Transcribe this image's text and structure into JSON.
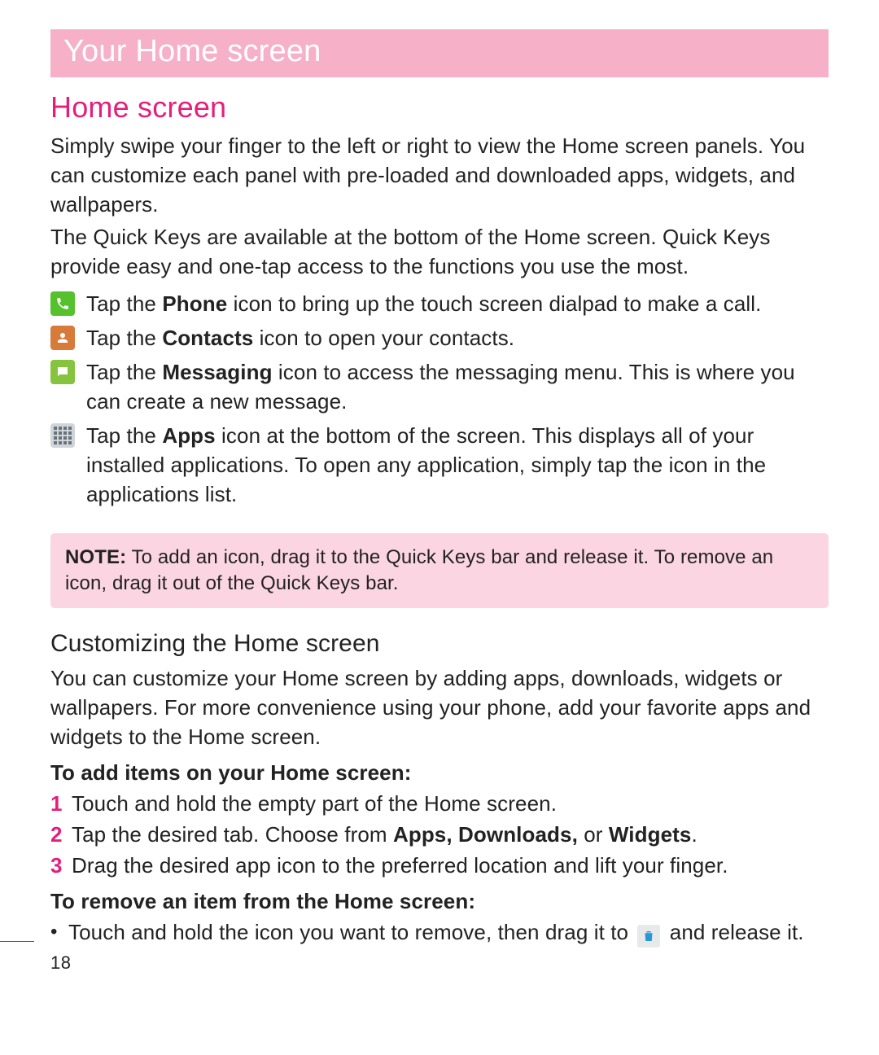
{
  "page_number": "18",
  "banner": "Your Home screen",
  "section1": {
    "heading": "Home screen",
    "para1": "Simply swipe your finger to the left or right to view the Home screen panels. You can customize each panel with pre-loaded and downloaded apps, widgets, and wallpapers.",
    "para2": "The Quick Keys are available at the bottom of the Home screen. Quick Keys provide easy and one-tap access to the functions you use the most.",
    "quickkeys": [
      {
        "icon": "phone-icon",
        "pre": "Tap the ",
        "bold": "Phone",
        "post": " icon to bring up the touch screen dialpad to make a call."
      },
      {
        "icon": "contacts-icon",
        "pre": "Tap the ",
        "bold": "Contacts",
        "post": " icon to open your contacts."
      },
      {
        "icon": "messaging-icon",
        "pre": "Tap the ",
        "bold": "Messaging",
        "post": " icon to access the messaging menu. This is where you can create a new message."
      },
      {
        "icon": "apps-icon",
        "pre": "Tap the ",
        "bold": "Apps",
        "post": " icon at the bottom of the screen. This displays all of your installed applications. To open any application, simply tap the icon in the applications list."
      }
    ]
  },
  "note": {
    "label": "NOTE:",
    "text": " To add an icon, drag it to the Quick Keys bar and release it. To remove an icon, drag it out of the Quick Keys bar."
  },
  "section2": {
    "heading": "Customizing the Home screen",
    "para": "You can customize your Home screen by adding apps, downloads, widgets or wallpapers. For more convenience using your phone, add your favorite apps and widgets to the Home screen.",
    "sub_add": {
      "heading": "To add items on your Home screen:",
      "steps": [
        "Touch and hold the empty part of the Home screen.",
        {
          "pre": "Tap the desired tab. Choose from ",
          "bold1": "Apps, Downloads,",
          "mid": " or ",
          "bold2": "Widgets",
          "post": "."
        },
        "Drag the desired app icon to the preferred location and lift your finger."
      ]
    },
    "sub_remove": {
      "heading": "To remove an item from the Home screen:",
      "bullet_pre": "Touch and hold the icon you want to remove, then drag it to ",
      "bullet_post": " and release it."
    }
  }
}
